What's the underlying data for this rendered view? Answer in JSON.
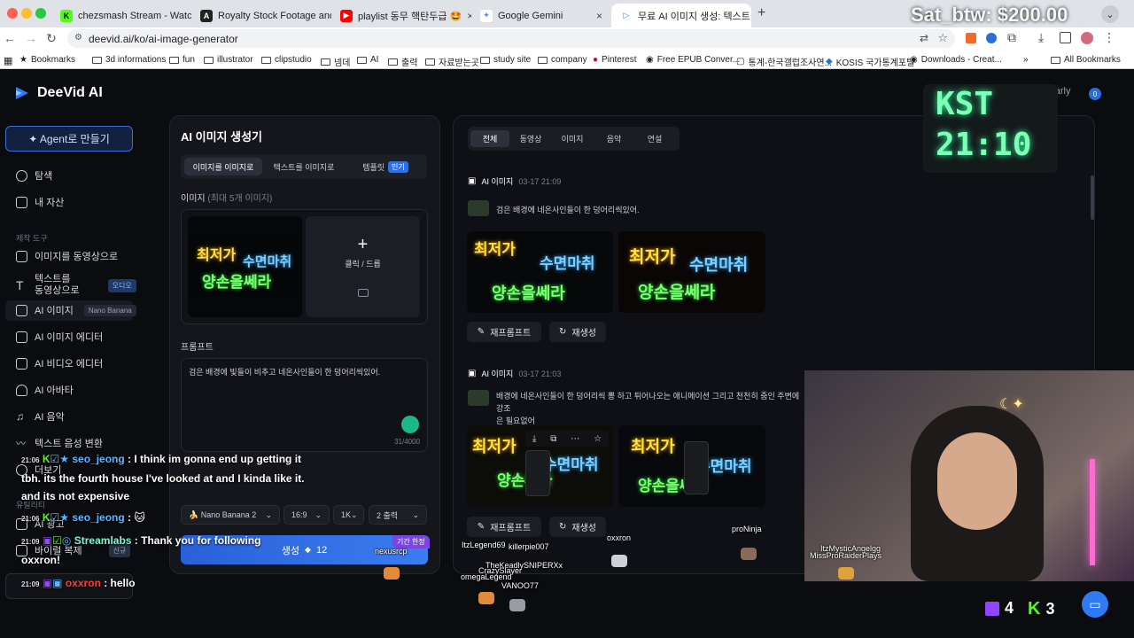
{
  "browser": {
    "tabs": [
      {
        "label": "chezsmash Stream - Watch L",
        "favicon": "K",
        "color": "#53fc18"
      },
      {
        "label": "Royalty Stock Footage and V",
        "favicon": "A",
        "color": "#222222"
      },
      {
        "label": "playlist 동무 핵탄두급 🤩 ",
        "favicon": "▶",
        "color": "#ff0000"
      },
      {
        "label": "Google Gemini",
        "favicon": "✦",
        "color": "#4285f4"
      },
      {
        "label": "무료 AI 이미지 생성: 텍스트·사진",
        "favicon": "▷",
        "color": "#2f7bf5"
      }
    ],
    "url": "deevid.ai/ko/ai-image-generator",
    "bookmarks": [
      "Bookmarks",
      "3d informations",
      "fun",
      "illustrator",
      "clipstudio",
      "넴데",
      "AI",
      "출력",
      "자료받는곳",
      "study site",
      "company",
      "Pinterest",
      "Free EPUB Conver...",
      "통계-한국갤럽조사연...",
      "KOSIS 국가통계포털",
      "Downloads - Creat...",
      "All Bookmarks"
    ]
  },
  "app": {
    "brand": "DeeVid AI",
    "plan": "Pro-Yearly",
    "plan_credits": "0",
    "agent_button": "✦ Agent로 만들기",
    "nav": [
      {
        "label": "탐색"
      },
      {
        "label": "내 자산"
      }
    ],
    "tools_heading": "제작 도구",
    "tools": [
      {
        "label": "이미지를 동영상으로",
        "badge": ""
      },
      {
        "label": "텍스트를\n동영상으로",
        "badge": "오디오"
      },
      {
        "label": "AI 이미지",
        "badge": "Nano Banana"
      },
      {
        "label": "AI 이미지 에디터",
        "badge": ""
      },
      {
        "label": "AI 비디오 에디터",
        "badge": ""
      },
      {
        "label": "AI 아바타",
        "badge": ""
      },
      {
        "label": "AI 음악",
        "badge": ""
      },
      {
        "label": "텍스트 음성 변환",
        "badge": ""
      },
      {
        "label": "더보기",
        "badge": ""
      }
    ],
    "other_heading": "유틸리티",
    "other": [
      {
        "label": "AI 광고",
        "badge": ""
      },
      {
        "label": "바이럴 복제",
        "badge": "신규"
      }
    ],
    "generator": {
      "title": "AI 이미지 생성기",
      "modes": [
        "이미지를 이미지로",
        "텍스트를 이미지로",
        "템플릿"
      ],
      "template_badge": "인기",
      "image_label": "이미지",
      "image_hint": "(최대 5개 이미지)",
      "thumb_text": [
        "최저가",
        "수면마취",
        "양손을쎄라"
      ],
      "upload_label": "클릭 / 드롭",
      "prompt_label": "프롬프트",
      "prompt_value": "검은 배경에 빛들이 비추고 네온사인들이 한 덩어리씩있어.",
      "char_count": "31/4000",
      "model": "Nano Banana 2",
      "aspect": "16:9",
      "resolution": "1K",
      "outputs": "2 출력",
      "generate_label": "생성",
      "generate_cost": "12",
      "limited_badge": "기간 한정"
    },
    "results": {
      "filters": [
        "전체",
        "동영상",
        "이미지",
        "음악",
        "연설"
      ],
      "cards": [
        {
          "type": "AI 이미지",
          "time": "03-17 21:09",
          "prompt": "검은 배경에 네온사인들이 한 덩어리씩있어."
        },
        {
          "type": "AI 이미지",
          "time": "03-17 21:03",
          "prompt": "배경에 네온사인들이 한 덩어리씩 뽕 하고 튀어나오는 애니메이션 그리고 천천히 줌인 주변에 강조\n은 필요없어"
        }
      ],
      "remake_label": "재프롬프트",
      "regen_label": "재생성"
    }
  },
  "overlay": {
    "sat_btw": "Sat_btw: $200.00",
    "kst_label": "KST",
    "kst_time": "21:10",
    "twitch_count": "4",
    "kick_count": "3",
    "chat": [
      {
        "time": "21:06",
        "user": "seo_jeong",
        "msg": "I think im gonna end up getting it tbh. its the fourth house I've looked at and I kinda like it. and its not expensive"
      },
      {
        "time": "21:06",
        "user": "seo_jeong",
        "msg": "🐱"
      },
      {
        "time": "21:09",
        "user": "Streamlabs",
        "msg": "Thank you for following oxxron!"
      },
      {
        "time": "21:09",
        "user": "oxxron",
        "msg": "hello"
      }
    ],
    "pets": [
      "nexusrcp",
      "ItzLegend69",
      "killerpie007",
      "oxxron",
      "proNinja",
      "TheKeadlySNIPERXx",
      "CrazySlayer",
      "omegaLegend",
      "VANOO77",
      "ItzMysticAngelgg",
      "MissProRaiderPlays"
    ]
  }
}
